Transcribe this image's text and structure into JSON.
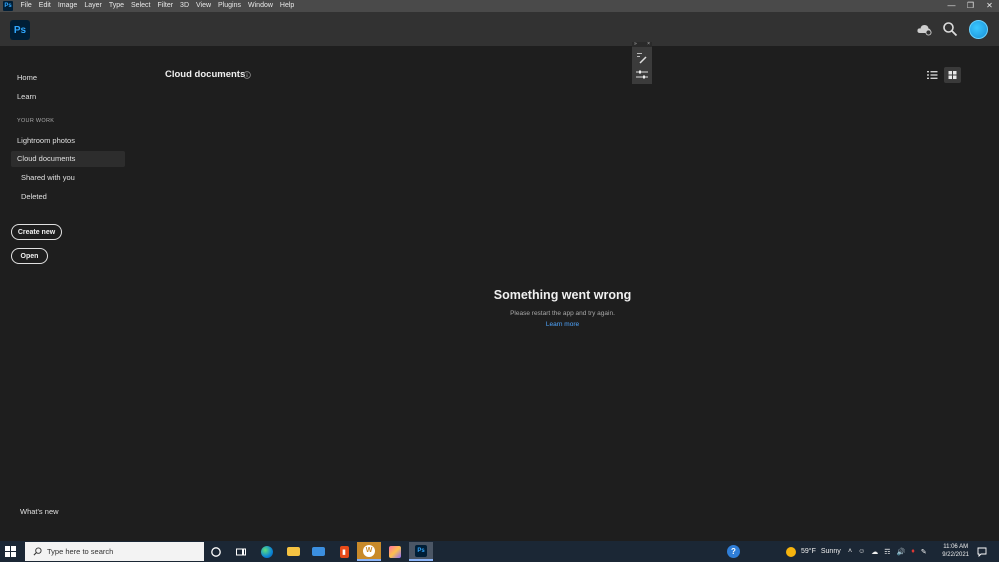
{
  "menubar": {
    "app_icon": "ps-icon",
    "items": [
      "File",
      "Edit",
      "Image",
      "Layer",
      "Type",
      "Select",
      "Filter",
      "3D",
      "View",
      "Plugins",
      "Window",
      "Help"
    ],
    "window_controls": [
      "minimize-icon",
      "restore-icon",
      "close-icon"
    ]
  },
  "header": {
    "logo_text": "Ps",
    "icons": [
      "cloud-sync-icon",
      "search-icon",
      "avatar"
    ]
  },
  "sidebar": {
    "home": "Home",
    "learn": "Learn",
    "section_label": "YOUR WORK",
    "lightroom": "Lightroom photos",
    "cloud_documents": "Cloud documents",
    "shared": "Shared with you",
    "deleted": "Deleted",
    "create_new": "Create new",
    "open": "Open",
    "whats_new": "What's new"
  },
  "main": {
    "title": "Cloud documents",
    "view_modes": [
      "list-view-icon",
      "grid-view-icon"
    ],
    "active_view": "grid",
    "error": {
      "title": "Something went wrong",
      "message": "Please restart the app and try again.",
      "link": "Learn more"
    }
  },
  "taskbar": {
    "search_placeholder": "Type here to search",
    "apps": [
      "cortana-icon",
      "task-view-icon",
      "edge-icon",
      "file-explorer-icon",
      "mail-icon",
      "office-icon",
      "app-w-icon",
      "photos-icon",
      "photoshop-icon"
    ],
    "weather": {
      "temp": "59°F",
      "condition": "Sunny"
    },
    "time": "11:06 AM",
    "date": "9/22/2021"
  },
  "colors": {
    "accent_link": "#4fa6ff",
    "ps_blue": "#31a8ff",
    "background": "#1e1e1e",
    "taskbar": "#1b2735"
  }
}
